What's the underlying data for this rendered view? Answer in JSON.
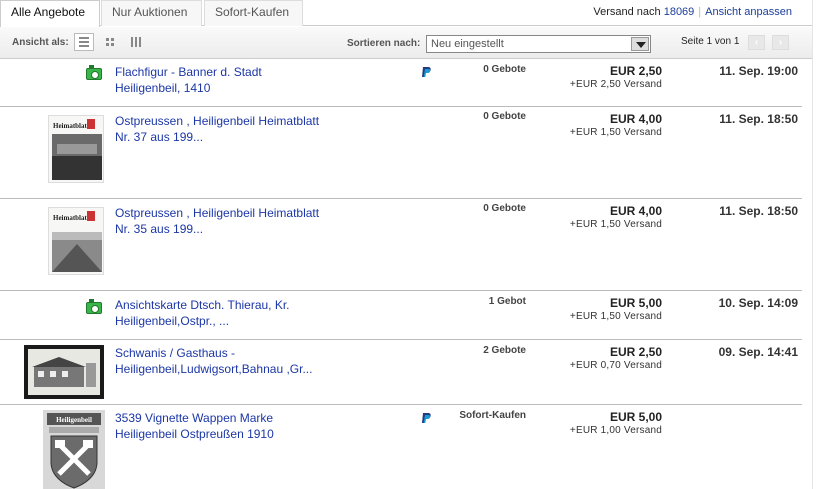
{
  "tabs": [
    {
      "label": "Alle Angebote"
    },
    {
      "label": "Nur Auktionen"
    },
    {
      "label": "Sofort-Kaufen"
    }
  ],
  "shipping": {
    "prefix": "Versand nach",
    "zip": "18069",
    "customize": "Ansicht anpassen"
  },
  "toolbar": {
    "view_label": "Ansicht als:",
    "sort_label": "Sortieren nach:",
    "sort_value": "Neu eingestellt",
    "page_info": "Seite 1 von 1"
  },
  "listings": [
    {
      "title": "Flachfigur - Banner d. Stadt Heiligenbeil, 1410",
      "bids": "0 Gebote",
      "price": "EUR 2,50",
      "shipping": "+EUR 2,50 Versand",
      "date": "11. Sep. 19:00",
      "paypal": true,
      "thumb": "camera-icon"
    },
    {
      "title": "Ostpreussen , Heiligenbeil Heimatblatt Nr. 37 aus 199...",
      "bids": "0 Gebote",
      "price": "EUR 4,00",
      "shipping": "+EUR 1,50 Versand",
      "date": "11. Sep. 18:50",
      "paypal": false,
      "thumb": "magazine-image",
      "thumb_text": "Heimatblatt"
    },
    {
      "title": "Ostpreussen , Heiligenbeil Heimatblatt Nr. 35 aus 199...",
      "bids": "0 Gebote",
      "price": "EUR 4,00",
      "shipping": "+EUR 1,50 Versand",
      "date": "11. Sep. 18:50",
      "paypal": false,
      "thumb": "magazine-image",
      "thumb_text": "Heimatblatt"
    },
    {
      "title": "Ansichtskarte Dtsch. Thierau, Kr. Heiligenbeil,Ostpr., ...",
      "bids": "1 Gebot",
      "price": "EUR 5,00",
      "shipping": "+EUR 1,50 Versand",
      "date": "10. Sep. 14:09",
      "paypal": false,
      "thumb": "camera-icon"
    },
    {
      "title": "Schwanis / Gasthaus - Heiligenbeil,Ludwigsort,Bahnau ,Gr...",
      "bids": "2 Gebote",
      "price": "EUR 2,50",
      "shipping": "+EUR 0,70 Versand",
      "date": "09. Sep. 14:41",
      "paypal": false,
      "thumb": "postcard-image"
    },
    {
      "title": "3539 Vignette Wappen Marke Heiligenbeil Ostpreußen 1910",
      "bids": "Sofort-Kaufen",
      "price": "EUR 5,00",
      "shipping": "+EUR 1,00 Versand",
      "date": "",
      "paypal": true,
      "thumb": "coat-of-arms-image",
      "thumb_text": "Heiligenbeil"
    }
  ],
  "colors": {
    "link": "#1c37a6",
    "camera": "#39b54a",
    "paypal_dark": "#253b80",
    "paypal_light": "#179bd7"
  }
}
